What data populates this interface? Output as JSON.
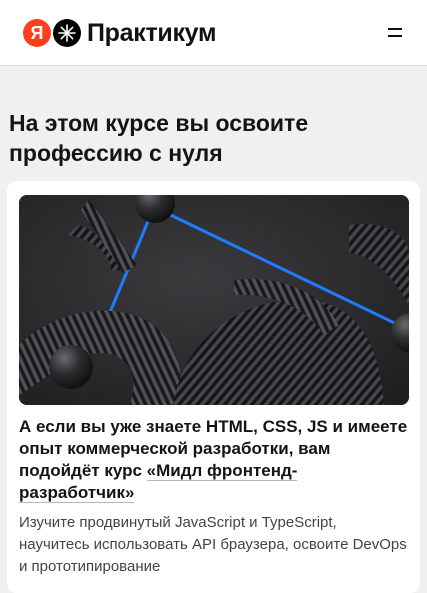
{
  "header": {
    "logo_ya": "Я",
    "brand": "Практикум"
  },
  "main": {
    "section_title": "На этом курсе вы освоите профессию с нуля",
    "card": {
      "heading_prefix": "А если вы уже знаете HTML, CSS, JS и имеете опыт коммерческой разработки, вам подойдёт курс",
      "course_link": "«Мидл фронтенд-разработчик»",
      "description": "Изучите продвинутый JavaScript и TypeScript, научитесь использовать API браузера, освоите DevOps и прототипирование"
    }
  },
  "colors": {
    "yandex_red": "#fc3f1d",
    "accent_blue": "#1f7bff",
    "page_bg": "#f0f0f0",
    "card_bg": "#ffffff"
  }
}
